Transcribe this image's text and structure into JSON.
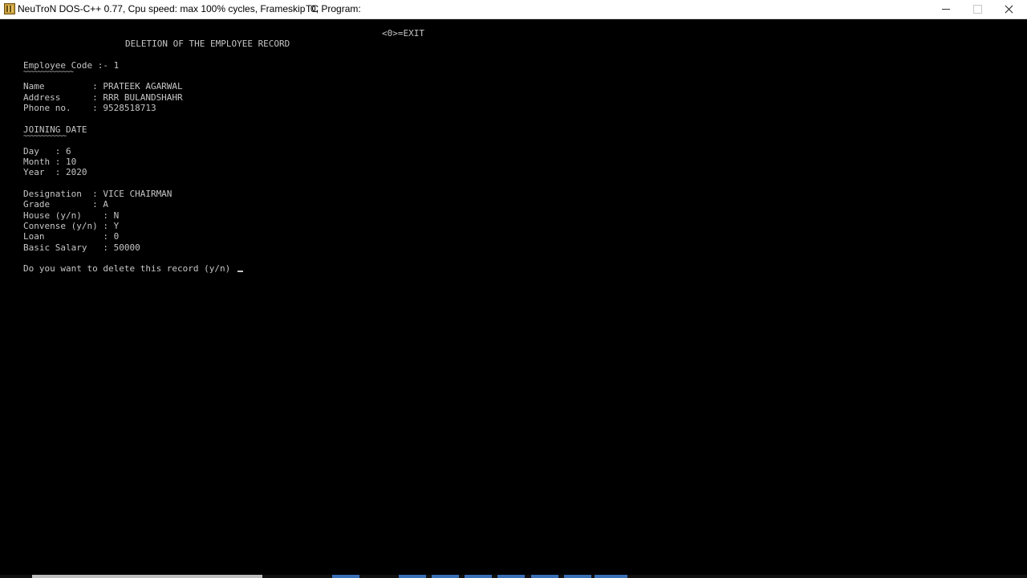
{
  "window": {
    "title": "NeuTroN DOS-C++ 0.77, Cpu speed: max 100% cycles, Frameskip  0, Program:",
    "program": "TC"
  },
  "screen": {
    "exit_hint": "<0>=EXIT",
    "heading": "DELETION OF THE EMPLOYEE RECORD",
    "employee_code_label": "Employee Code :- 1",
    "employee_code_underline": "~~~~~~~~~~~~~~",
    "name_line": "Name         : PRATEEK AGARWAL",
    "address_line": "Address      : RRR BULANDSHAHR",
    "phone_line": "Phone no.    : 9528518713",
    "joining_heading": "JOINING DATE",
    "joining_underline": "~~~~~~~~~~~~",
    "day_line": "Day   : 6",
    "month_line": "Month : 10",
    "year_line": "Year  : 2020",
    "designation_line": "Designation  : VICE CHAIRMAN",
    "grade_line": "Grade        : A",
    "house_line": "House (y/n)    : N",
    "convense_line": "Convense (y/n) : Y",
    "loan_line": "Loan           : 0",
    "salary_line": "Basic Salary   : 50000",
    "prompt": "Do you want to delete this record (y/n) "
  },
  "colors": {
    "background": "#000000",
    "text": "#c6c6c6",
    "titlebar": "#ffffff"
  },
  "icons": {
    "app": "dosbox-app-icon",
    "minimize": "minimize-icon",
    "maximize": "maximize-icon",
    "close": "close-icon"
  }
}
